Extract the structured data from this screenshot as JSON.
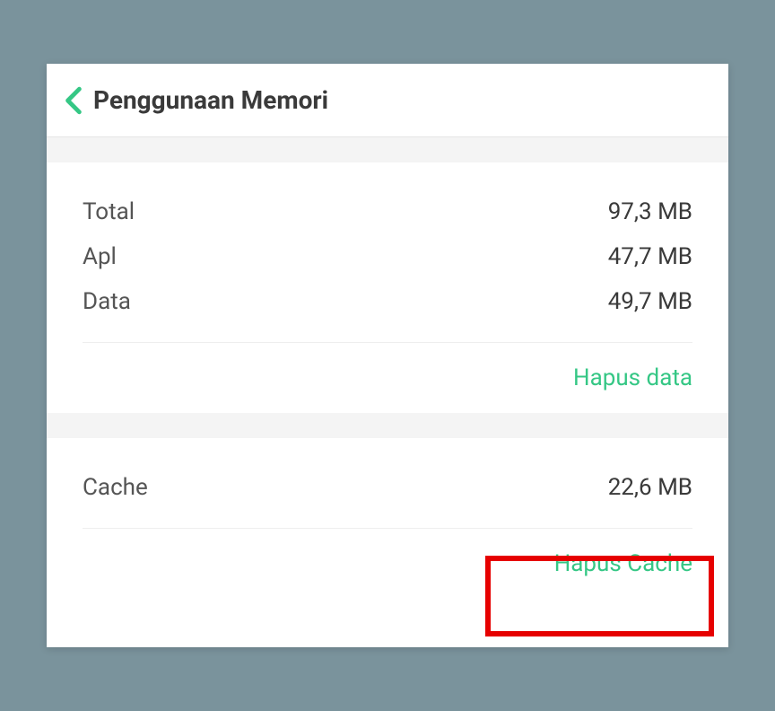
{
  "header": {
    "title": "Penggunaan Memori"
  },
  "storage": {
    "rows": [
      {
        "label": "Total",
        "value": "97,3 MB"
      },
      {
        "label": "Apl",
        "value": "47,7 MB"
      },
      {
        "label": "Data",
        "value": "49,7 MB"
      }
    ],
    "clearDataLabel": "Hapus data"
  },
  "cache": {
    "label": "Cache",
    "value": "22,6 MB",
    "clearCacheLabel": "Hapus Cache"
  }
}
